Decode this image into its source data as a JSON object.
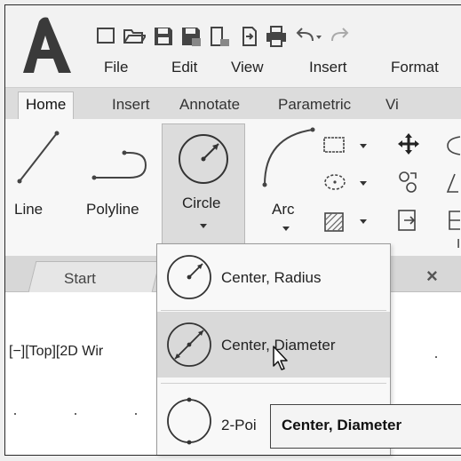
{
  "menu_bar": {
    "items": [
      "File",
      "Edit",
      "View",
      "Insert",
      "Format"
    ]
  },
  "ribbon_tabs": [
    "Home",
    "Insert",
    "Annotate",
    "Parametric",
    "Vi"
  ],
  "ribbon": {
    "tools": {
      "line": "Line",
      "polyline": "Polyline",
      "circle": "Circle",
      "arc": "Arc"
    }
  },
  "file_tabs": {
    "start": "Start",
    "close_glyph": "×"
  },
  "viewport": {
    "label": "[−][Top][2D Wir"
  },
  "circle_dropdown": {
    "items": [
      {
        "label": "Center, Radius",
        "icon": "circle-center-radius-icon"
      },
      {
        "label": "Center, Diameter",
        "icon": "circle-center-diameter-icon",
        "highlighted": true
      },
      {
        "label": "2-Poi",
        "icon": "circle-2-point-icon"
      }
    ]
  },
  "tooltip": {
    "text": "Center, Diameter"
  },
  "colors": {
    "app_logo": "#3a3a3a",
    "ribbon_bg": "#f7f7f7",
    "tab_strip_bg": "#dcdcdc",
    "highlight_bg": "#d9d9d9"
  }
}
